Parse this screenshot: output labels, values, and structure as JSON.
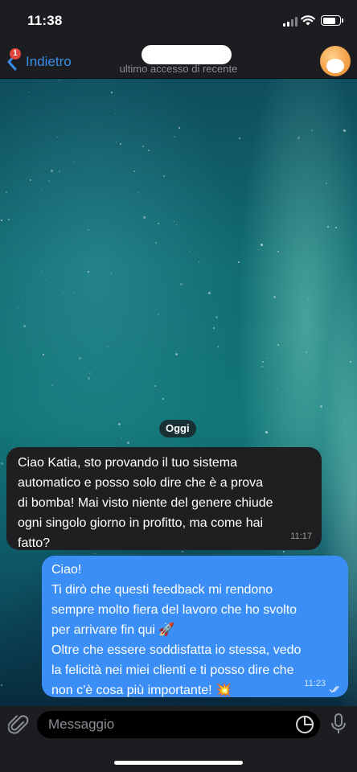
{
  "status_bar": {
    "time": "11:38",
    "signal_icon": "cellular-signal-icon",
    "wifi_icon": "wifi-icon",
    "battery_icon": "battery-icon",
    "battery_level": 0.8
  },
  "nav": {
    "back_label": "Indietro",
    "back_badge": "1",
    "contact_status": "ultimo accesso di recente",
    "avatar_icon": "contact-avatar"
  },
  "chat": {
    "date_label": "Oggi",
    "messages": [
      {
        "direction": "incoming",
        "text": "Ciao Katia, sto provando il tuo sistema\nautomatico e posso solo dire che è a prova\ndi bomba! Mai visto niente del genere chiude\nogni singolo giorno in profitto, ma come hai\nfatto?",
        "time": "11:17"
      },
      {
        "direction": "outgoing",
        "text": "Ciao!\nTi dirò che questi feedback mi rendono\nsempre molto fiera del lavoro che ho svolto\nper arrivare fin qui 🚀\nOltre che essere soddisfatta io stessa, vedo\nla felicità nei miei clienti e ti posso dire che\nnon c'è cosa più importante! 💥",
        "time": "11:23",
        "read_icon": "double-check-icon"
      }
    ]
  },
  "input": {
    "placeholder": "Messaggio",
    "attach_icon": "paperclip-icon",
    "sticker_icon": "sticker-icon",
    "mic_icon": "microphone-icon"
  },
  "colors": {
    "bar_background": "#1c1d20",
    "accent": "#3b8ee8",
    "outgoing_bubble": "#3b8ef5",
    "incoming_bubble": "#1f1f22",
    "badge": "#e0463e"
  }
}
